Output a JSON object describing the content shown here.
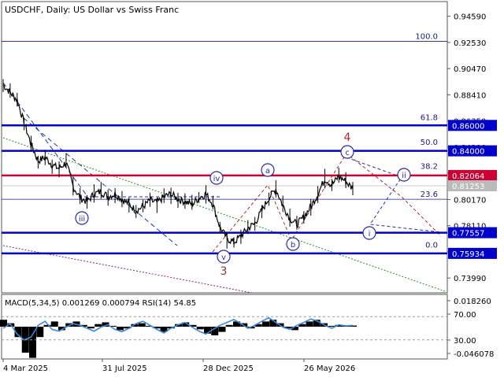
{
  "header": {
    "title": "USDCHF, Daily:  US Dollar vs Swiss Franc"
  },
  "price_axis": {
    "ticks": [
      "0.94590",
      "0.92530",
      "0.90470",
      "0.88410",
      "0.86350",
      "0.84290",
      "0.82230",
      "0.80170",
      "0.78110",
      "0.76050",
      "0.73990"
    ],
    "ylim": [
      0.7295,
      0.9562
    ]
  },
  "fib_labels": [
    {
      "label": "100.0",
      "price": 0.9262
    },
    {
      "label": "61.8",
      "price": 0.8623
    },
    {
      "label": "50.0",
      "price": 0.8429
    },
    {
      "label": "38.2",
      "price": 0.824
    },
    {
      "label": "23.6",
      "price": 0.8019
    },
    {
      "label": "0.0",
      "price": 0.762
    }
  ],
  "price_tags": [
    {
      "label": "0.86000",
      "price": 0.86,
      "color": "#0000cc"
    },
    {
      "label": "0.84000",
      "price": 0.84,
      "color": "#0000cc"
    },
    {
      "label": "0.82064",
      "price": 0.8206,
      "color": "#cc0033"
    },
    {
      "label": "0.81253",
      "price": 0.8125,
      "color": "#bbbbbb"
    },
    {
      "label": "0.77557",
      "price": 0.7756,
      "color": "#0000cc"
    },
    {
      "label": "0.75934",
      "price": 0.7593,
      "color": "#0000cc"
    }
  ],
  "wave_labels": [
    {
      "label": "iv",
      "style": "circle",
      "color": "#2a2aa0"
    },
    {
      "label": "a",
      "style": "circle",
      "color": "#2a2aa0"
    },
    {
      "label": "c",
      "style": "circle",
      "color": "#2a2aa0"
    },
    {
      "label": "ii",
      "style": "circle",
      "color": "#2a2aa0"
    },
    {
      "label": "iii",
      "style": "circle",
      "color": "#2a2aa0"
    },
    {
      "label": "i",
      "style": "circle",
      "color": "#2a2aa0"
    },
    {
      "label": "b",
      "style": "circle",
      "color": "#2a2aa0"
    },
    {
      "label": "v",
      "style": "circle",
      "color": "#2a2aa0"
    },
    {
      "label": "4",
      "style": "plain",
      "color": "#a0302a"
    },
    {
      "label": "3",
      "style": "plain",
      "color": "#a0302a"
    }
  ],
  "indicator": {
    "label": "MACD(5,34,5) 0.001269 0.000794 RSI(14) 54.85",
    "ticks": [
      "0.018260",
      "70.00",
      "30.00",
      "-0.046078"
    ]
  },
  "time_axis": {
    "labels": [
      "4 Mar 2025",
      "31 Jul 2025",
      "28 Dec 2025",
      "26 May 2026"
    ]
  },
  "colors": {
    "candles": "#000000",
    "support_resistance": "#0000cc",
    "key_level": "#cc0033",
    "fib_line": "#1a1a80",
    "rsi": "#3a88d8",
    "wave_minor": "#2a2aa0",
    "wave_major": "#a0302a"
  },
  "chart_data": {
    "type": "candlestick",
    "instrument": "USDCHF",
    "timeframe": "Daily",
    "x_dates": [
      "4 Mar 2025",
      "31 Jul 2025",
      "28 Dec 2025",
      "26 May 2026"
    ],
    "price_close_path": [
      0.892,
      0.886,
      0.88,
      0.862,
      0.845,
      0.832,
      0.835,
      0.829,
      0.826,
      0.831,
      0.812,
      0.803,
      0.8,
      0.806,
      0.808,
      0.804,
      0.806,
      0.802,
      0.798,
      0.793,
      0.796,
      0.801,
      0.799,
      0.804,
      0.806,
      0.802,
      0.8,
      0.798,
      0.803,
      0.806,
      0.798,
      0.78,
      0.771,
      0.768,
      0.773,
      0.779,
      0.783,
      0.793,
      0.803,
      0.81,
      0.797,
      0.787,
      0.782,
      0.788,
      0.796,
      0.806,
      0.818,
      0.813,
      0.82,
      0.816,
      0.81
    ],
    "horizontal_levels": [
      0.86,
      0.84,
      0.8206,
      0.7756,
      0.7593
    ],
    "current_price": 0.81253,
    "fibonacci": {
      "levels": [
        "100.0",
        "61.8",
        "50.0",
        "38.2",
        "23.6",
        "0.0"
      ],
      "prices": [
        0.9262,
        0.8623,
        0.8429,
        0.824,
        0.8019,
        0.762
      ]
    },
    "rsi_close_path": [
      50,
      58,
      40,
      30,
      35,
      55,
      62,
      48,
      45,
      52,
      58,
      55,
      50,
      45,
      52,
      56,
      48,
      44,
      50,
      58,
      62,
      55,
      48,
      42,
      50,
      56,
      60,
      52,
      45,
      40,
      48,
      55,
      60,
      65,
      58,
      50,
      55,
      62,
      68,
      60,
      52,
      48,
      55,
      60,
      66,
      62,
      55,
      50,
      56,
      54,
      55
    ],
    "macd_hist": [
      0.008,
      0.004,
      -0.012,
      -0.03,
      -0.036,
      -0.012,
      0.002,
      0.006,
      -0.004,
      0.004,
      0.006,
      0.002,
      -0.002,
      0.003,
      0.005,
      0.001,
      -0.004,
      -0.002,
      0.003,
      0.004,
      0.001,
      -0.002,
      -0.006,
      -0.002,
      0.003,
      0.005,
      0.002,
      -0.003,
      -0.008,
      -0.01,
      -0.006,
      0.002,
      0.006,
      0.004,
      -0.002,
      0.003,
      0.006,
      0.008,
      0.004,
      -0.002,
      -0.004,
      0.003,
      0.006,
      0.008,
      0.004,
      0.001,
      0.002,
      0.001,
      0.0013
    ]
  }
}
